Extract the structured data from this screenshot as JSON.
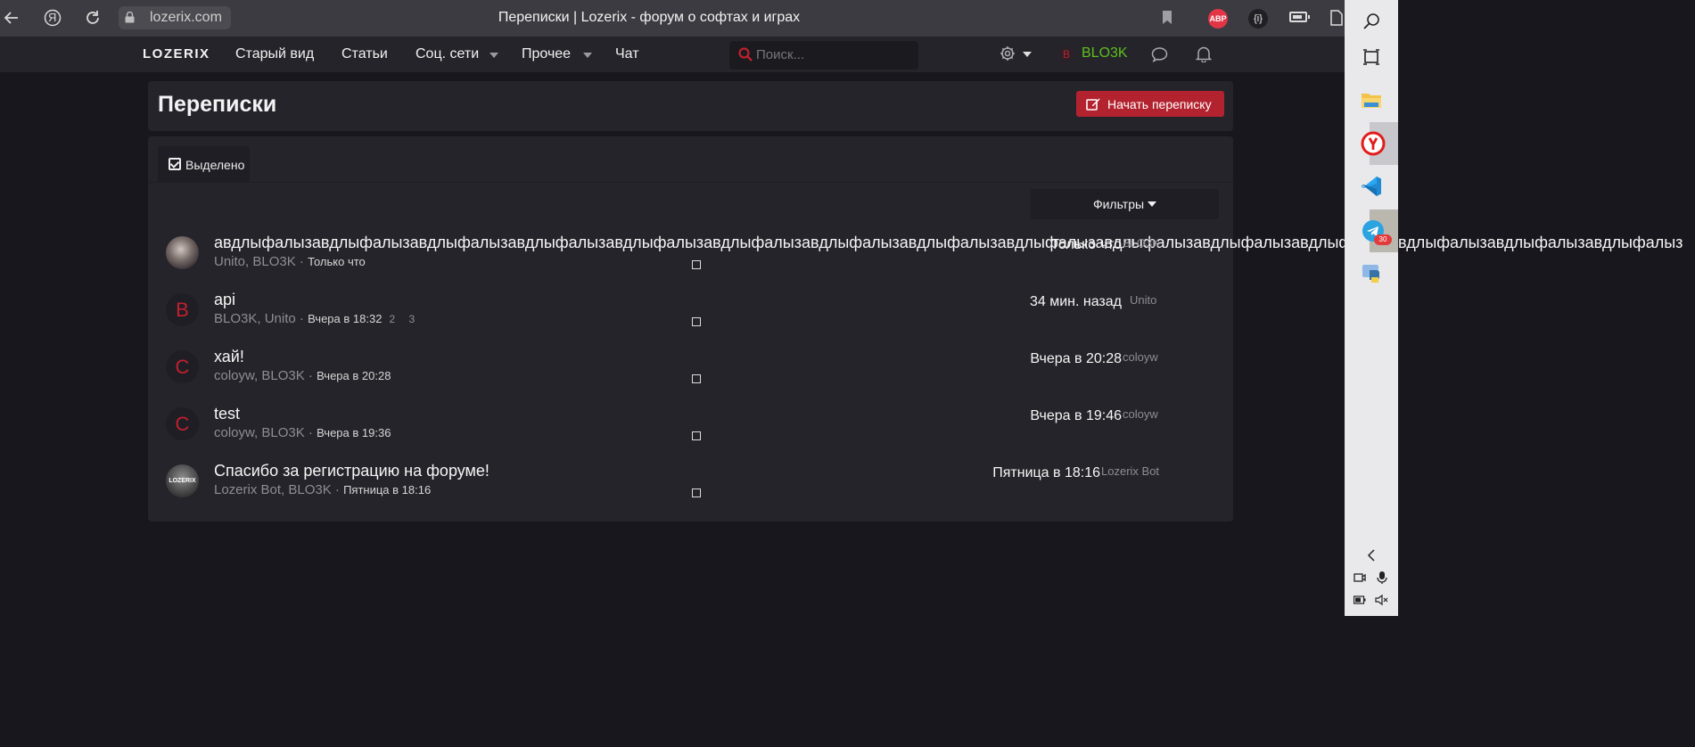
{
  "browser": {
    "url": "lozerix.com",
    "tab_title": "Переписки | Lozerix - форум о софтах и играх",
    "yandex_glyph": "Я",
    "abp_label": "ABP",
    "ext_glyph": "{i}"
  },
  "navbar": {
    "logo": "LOZERIX",
    "links": [
      "Старый вид",
      "Статьи",
      "Соц. сети",
      "Прочее",
      "Чат"
    ],
    "search_placeholder": "Поиск...",
    "user_initial": "B",
    "user_name": "BLO3K",
    "accent_color": "#c0202f",
    "username_color": "#5ec01d"
  },
  "page": {
    "title": "Переписки",
    "start_button": "Начать переписку",
    "selected_tab": "Выделено",
    "filters_button": "Фильтры"
  },
  "conversations": [
    {
      "title": "авдлыфалызавдлыфалызавдлыфалызавдлыфалызавдлыфалызавдлыфалызавдлыфалызавдлыфалызавдлыфалызавдлыфалызавдлыфалызавдлыфалызавдлыфалызавдлыфалызавдлыфалыз",
      "participants": "Unito, BLO3K",
      "started": "Только что",
      "pages": "",
      "last_reply": "Только что",
      "last_user": "BLO3K",
      "avatar_initial": "",
      "avatar_type": "photo"
    },
    {
      "title": "api",
      "participants": "BLO3K, Unito",
      "started": "Вчера в 18:32",
      "pages": "2 3",
      "last_reply": "34 мин. назад",
      "last_user": "Unito",
      "avatar_initial": "B",
      "avatar_type": "letter"
    },
    {
      "title": "хай!",
      "participants": "coloyw, BLO3K",
      "started": "Вчера в 20:28",
      "pages": "",
      "last_reply": "Вчера в 20:28",
      "last_user": "coloyw",
      "avatar_initial": "C",
      "avatar_type": "letter"
    },
    {
      "title": "test",
      "participants": "coloyw, BLO3K",
      "started": "Вчера в 19:36",
      "pages": "",
      "last_reply": "Вчера в 19:46",
      "last_user": "coloyw",
      "avatar_initial": "C",
      "avatar_type": "letter"
    },
    {
      "title": "Спасибо за регистрацию на форуме!",
      "participants": "Lozerix Bot, BLO3K",
      "started": "Пятница в 18:16",
      "pages": "",
      "last_reply": "Пятница в 18:16",
      "last_user": "Lozerix Bot",
      "avatar_initial": "LOZERIX",
      "avatar_type": "bot"
    }
  ],
  "taskbar": {
    "telegram_badge": "30",
    "icons": [
      "search-icon",
      "task-view-icon",
      "file-explorer-icon",
      "yandex-browser-icon",
      "vscode-icon",
      "telegram-icon",
      "python-icon",
      "chevron-left-icon",
      "meet-now-icon",
      "microphone-icon",
      "battery-icon",
      "volume-muted-icon"
    ]
  }
}
